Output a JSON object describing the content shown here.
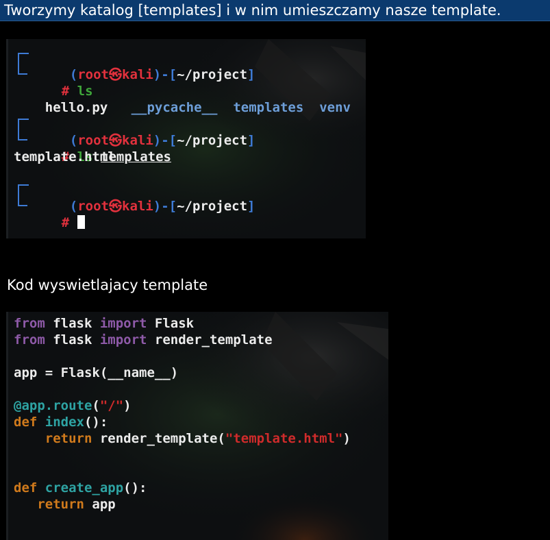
{
  "banner": {
    "text": "Tworzymy katalog [templates] i w nim umieszczamy nasze template."
  },
  "terminal_top": {
    "prompts": [
      {
        "open": "(",
        "user": "root",
        "at_symbol": "㉿",
        "host": "kali",
        "close": ")-[",
        "path": "~/project",
        "end": "]",
        "hash": "#",
        "command": "ls",
        "arg": ""
      },
      {
        "open": "(",
        "user": "root",
        "at_symbol": "㉿",
        "host": "kali",
        "close": ")-[",
        "path": "~/project",
        "end": "]",
        "hash": "#",
        "command": "ls",
        "arg": "templates"
      },
      {
        "open": "(",
        "user": "root",
        "at_symbol": "㉿",
        "host": "kali",
        "close": ")-[",
        "path": "~/project",
        "end": "]",
        "hash": "#",
        "command": "",
        "arg": ""
      }
    ],
    "ls_output": {
      "file": "hello.py",
      "dir1": "__pycache__",
      "dir2": "templates",
      "dir3": "venv"
    },
    "ls_templates_output": "template.html"
  },
  "section2": {
    "heading": "Kod wyswietlajacy template"
  },
  "code": {
    "l1": {
      "kw": "from",
      "mod": " flask ",
      "kw2": "import",
      "name": " Flask"
    },
    "l2": {
      "kw": "from",
      "mod": " flask ",
      "kw2": "import",
      "name": " render_template"
    },
    "l3": {
      "text": "app = Flask(__name__)"
    },
    "l4": {
      "deco": "@app.route",
      "p1": "(",
      "str": "\"/\"",
      "p2": ")"
    },
    "l5": {
      "kw": "def",
      "fn": " index",
      "rest": "():"
    },
    "l6": {
      "indent": "    ",
      "kw": "return",
      "call": " render_template(",
      "str": "\"template.html\"",
      "end": ")"
    },
    "l7": {
      "kw": "def",
      "fn": " create_app",
      "rest": "():"
    },
    "l8": {
      "indent": "   ",
      "kw": "return",
      "rest": " app"
    }
  },
  "colors": {
    "banner_bg": "#0b3a6e",
    "prompt_blue": "#3e7bd6",
    "prompt_red": "#e2313d",
    "command_green": "#3fa63a",
    "dir_blue": "#6d9ed8",
    "keyword_purple": "#8e5aa8",
    "keyword_orange": "#d07a1c",
    "func_teal": "#2ea3a3",
    "string_red": "#cf2b2b"
  }
}
